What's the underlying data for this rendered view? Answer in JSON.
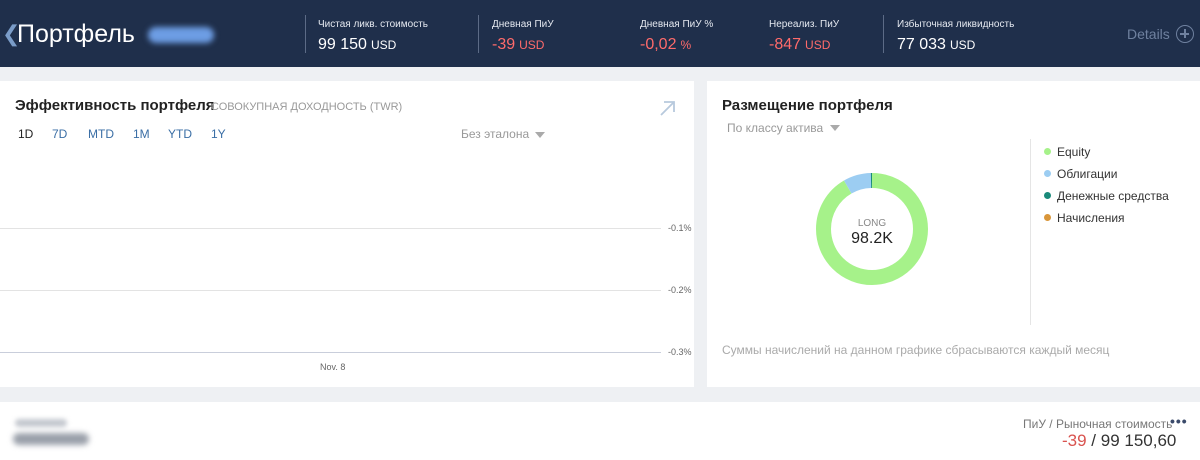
{
  "header": {
    "back_glyph": "❮",
    "title": "Портфель",
    "stats": [
      {
        "label": "Чистая ликв. стоимость",
        "value": "99 150",
        "unit": "USD",
        "tone": "normal"
      },
      {
        "label": "Дневная ПиУ",
        "value": "-39",
        "unit": "USD",
        "tone": "negative"
      },
      {
        "label": "Дневная ПиУ %",
        "value": "-0,02",
        "unit": "%",
        "tone": "negative"
      },
      {
        "label": "Нереализ. ПиУ",
        "value": "-847",
        "unit": "USD",
        "tone": "negative"
      },
      {
        "label": "Избыточная ликвидность",
        "value": "77 033",
        "unit": "USD",
        "tone": "normal"
      }
    ],
    "details_label": "Details"
  },
  "performance": {
    "title": "Эффективность портфеля",
    "subtitle": "СОВОКУПНАЯ ДОХОДНОСТЬ (TWR)",
    "ranges": [
      "1D",
      "7D",
      "MTD",
      "1M",
      "YTD",
      "1Y"
    ],
    "active_range": "1D",
    "benchmark": "Без эталона"
  },
  "chart_data": {
    "type": "line",
    "title": "",
    "xlabel": "",
    "ylabel": "",
    "x_ticks": [
      "Nov. 8"
    ],
    "y_ticks": [
      "-0.1%",
      "-0.2%",
      "-0.3%"
    ],
    "series": [],
    "grid": true
  },
  "allocation": {
    "title": "Размещение портфеля",
    "group_by": "По классу актива",
    "donut": {
      "center_label": "LONG",
      "center_value": "98.2K",
      "slices": [
        {
          "name": "Equity",
          "share": 0.915,
          "color": "#a6f28a"
        },
        {
          "name": "Облигации",
          "share": 0.08,
          "color": "#9ccdf2"
        },
        {
          "name": "Денежные средства",
          "share": 0.005,
          "color": "#1a8a7a"
        },
        {
          "name": "Начисления",
          "share": 0.0,
          "color": "#d9963a"
        }
      ]
    },
    "note": "Суммы начислений на данном графике сбрасываются каждый месяц"
  },
  "bottom": {
    "pnl_label": "ПиУ / Рыночная стоимость",
    "more_glyph": "•••",
    "pnl_value": "-39",
    "separator": " / ",
    "market_value": "99 150,60"
  },
  "colors": {
    "header_bg": "#1f2f4b",
    "negative": "#ff6b6b",
    "accent_link": "#3a6ea5"
  }
}
